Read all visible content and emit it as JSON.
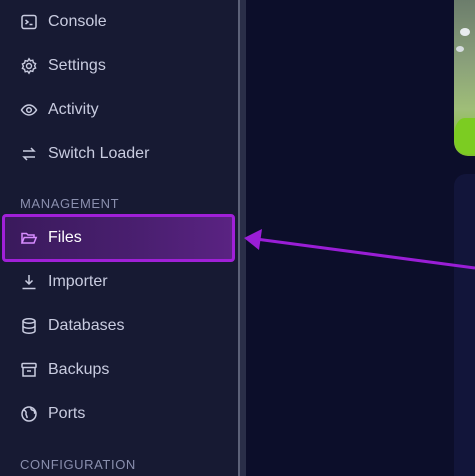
{
  "sidebar": {
    "top_items": [
      {
        "label": "Console",
        "icon": "terminal-icon"
      },
      {
        "label": "Settings",
        "icon": "gear-icon"
      },
      {
        "label": "Activity",
        "icon": "eye-icon"
      },
      {
        "label": "Switch Loader",
        "icon": "switch-arrows-icon"
      }
    ],
    "management_label": "MANAGEMENT",
    "management_items": [
      {
        "label": "Files",
        "icon": "folder-open-icon",
        "active": true
      },
      {
        "label": "Importer",
        "icon": "download-icon"
      },
      {
        "label": "Databases",
        "icon": "database-icon"
      },
      {
        "label": "Backups",
        "icon": "archive-icon"
      },
      {
        "label": "Ports",
        "icon": "globe-icon"
      }
    ],
    "configuration_label": "CONFIGURATION"
  },
  "colors": {
    "highlight": "#a020d8",
    "sidebar_bg": "#171a33",
    "main_bg": "#0c0e2a"
  }
}
